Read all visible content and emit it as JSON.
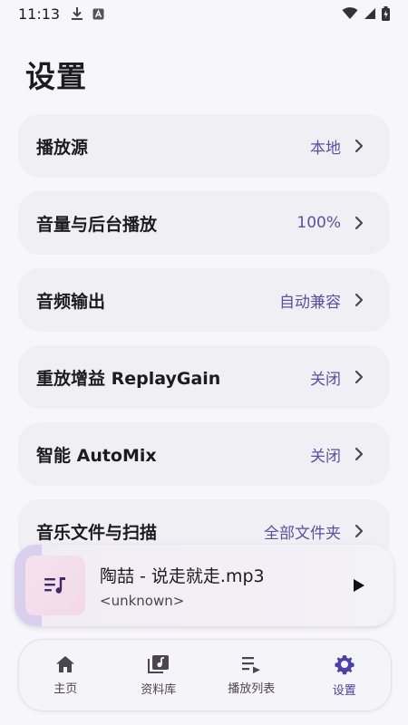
{
  "status_bar": {
    "time": "11:13",
    "left_icons": [
      "download-icon",
      "a-letter-icon"
    ],
    "right_icons": [
      "wifi-icon",
      "signal-icon",
      "battery-icon"
    ]
  },
  "page": {
    "title": "设置"
  },
  "settings": [
    {
      "label": "播放源",
      "value": "本地",
      "icon": "chevron-right-icon"
    },
    {
      "label": "音量与后台播放",
      "value": "100%",
      "icon": "chevron-right-icon"
    },
    {
      "label": "音频输出",
      "value": "自动兼容",
      "icon": "chevron-right-icon"
    },
    {
      "label": "重放增益 ReplayGain",
      "value": "关闭",
      "icon": "chevron-right-icon"
    },
    {
      "label": "智能 AutoMix",
      "value": "关闭",
      "icon": "chevron-right-icon"
    },
    {
      "label": "音乐文件与扫描",
      "value": "全部文件夹",
      "icon": "chevron-right-icon"
    }
  ],
  "mini_player": {
    "title": "陶喆 - 说走就走.mp3",
    "artist": "<unknown>",
    "art_icon": "music-list-icon",
    "play_icon": "play-icon"
  },
  "bottom_nav": [
    {
      "label": "主页",
      "icon": "home-icon",
      "active": false
    },
    {
      "label": "资料库",
      "icon": "library-icon",
      "active": false
    },
    {
      "label": "播放列表",
      "icon": "playlist-icon",
      "active": false
    },
    {
      "label": "设置",
      "icon": "gear-icon",
      "active": true
    }
  ],
  "colors": {
    "accent": "#4E3FB0",
    "value_text": "#5B4FA8",
    "card_bg": "#F0EFF4",
    "page_bg": "#F7F6FA"
  }
}
